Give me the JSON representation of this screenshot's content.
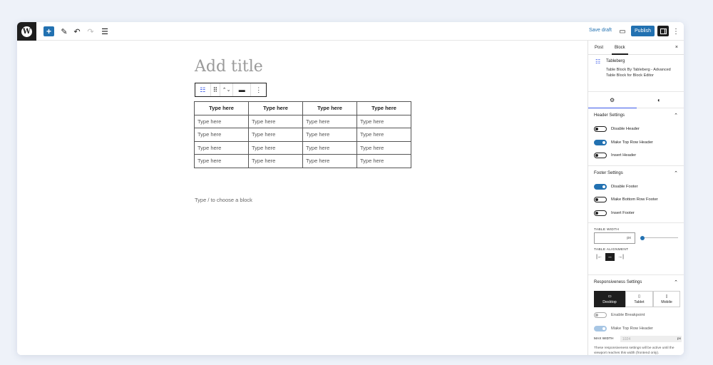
{
  "topbar": {
    "logo_letter": "W",
    "add_symbol": "+",
    "tools_symbol": "✎",
    "undo_symbol": "↶",
    "redo_symbol": "↷",
    "outline_symbol": "☰",
    "save_draft": "Save draft",
    "preview_symbol": "▭",
    "publish": "Publish",
    "more_symbol": "⋮"
  },
  "editor": {
    "title_placeholder": "Add title",
    "toolbar": {
      "block_icon": "☷",
      "drag": "⠿",
      "move": "⌃⌄",
      "align": "▬",
      "more": "⋮"
    },
    "table": {
      "headers": [
        "Type here",
        "Type here",
        "Type here",
        "Type here"
      ],
      "rows": [
        [
          "Type here",
          "Type here",
          "Type here",
          "Type here"
        ],
        [
          "Type here",
          "Type here",
          "Type here",
          "Type here"
        ],
        [
          "Type here",
          "Type here",
          "Type here",
          "Type here"
        ],
        [
          "Type here",
          "Type here",
          "Type here",
          "Type here"
        ]
      ]
    },
    "appender": "Type / to choose a block"
  },
  "sidebar": {
    "tabs": [
      "Post",
      "Block"
    ],
    "close": "×",
    "block_card": {
      "icon": "☷",
      "title": "Tableberg",
      "description": "Table Block By Tableberg - Advanced Table Block for Block Editor"
    },
    "subtab_settings_icon": "⚙",
    "subtab_styles_icon": "◐",
    "header_settings": {
      "title": "Header Settings",
      "chevron": "⌃",
      "toggles": [
        {
          "label": "Disable Header",
          "state": "off"
        },
        {
          "label": "Make Top Row Header",
          "state": "on"
        },
        {
          "label": "Insert Header",
          "state": "off"
        }
      ]
    },
    "footer_settings": {
      "title": "Footer Settings",
      "chevron": "⌃",
      "toggles": [
        {
          "label": "Disable Footer",
          "state": "on"
        },
        {
          "label": "Make Bottom Row Footer",
          "state": "off"
        },
        {
          "label": "Insert Footer",
          "state": "off"
        }
      ]
    },
    "table_width": {
      "label": "TABLE WIDTH",
      "unit": "px",
      "slider_value": 0
    },
    "table_alignment": {
      "label": "TABLE ALIGNMENT",
      "options": [
        "|←",
        "↔",
        "→|"
      ],
      "selected": 1
    },
    "responsiveness": {
      "title": "Responsiveness Settings",
      "chevron": "⌃",
      "devices": [
        {
          "label": "Desktop",
          "icon": "▭",
          "selected": true
        },
        {
          "label": "Tablet",
          "icon": "▯",
          "selected": false
        },
        {
          "label": "Mobile",
          "icon": "▯",
          "selected": false
        }
      ],
      "toggles": [
        {
          "label": "Enable Breakpoint",
          "state": "off-disabled"
        },
        {
          "label": "Make Top Row Header",
          "state": "on-disabled"
        }
      ],
      "max_width_label": "MAX WIDTH",
      "max_width_placeholder": "1024",
      "max_width_unit": "px",
      "note": "These responsiveness settings will be active until the viewport reaches this width (frontend only)."
    }
  }
}
